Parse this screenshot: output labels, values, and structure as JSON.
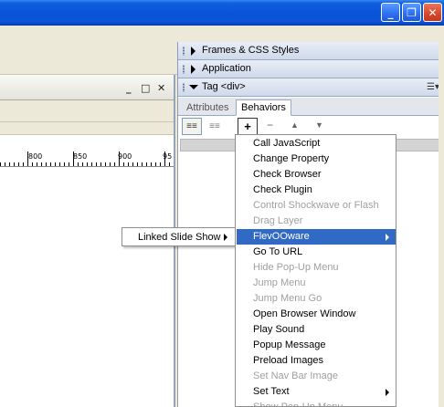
{
  "window": {
    "minimize_icon": "minimize-icon",
    "maximize_icon": "restore-icon",
    "close_icon": "close-icon"
  },
  "document": {
    "controls": {
      "minimize": "_",
      "restore": "□",
      "close": "✕"
    },
    "ruler_labels": [
      "800",
      "850",
      "900",
      "95"
    ]
  },
  "panels": {
    "frames_css": "Frames & CSS Styles",
    "application": "Application",
    "tag": "Tag <div>"
  },
  "tabs": {
    "attributes": "Attributes",
    "behaviors": "Behaviors"
  },
  "toolbar": {
    "add": "+",
    "remove": "−",
    "up": "▲",
    "down": "▼"
  },
  "submenu": {
    "label": "Linked Slide Show"
  },
  "menu": {
    "items": [
      {
        "label": "Call JavaScript",
        "disabled": false,
        "submenu": false
      },
      {
        "label": "Change Property",
        "disabled": false,
        "submenu": false
      },
      {
        "label": "Check Browser",
        "disabled": false,
        "submenu": false
      },
      {
        "label": "Check Plugin",
        "disabled": false,
        "submenu": false
      },
      {
        "label": "Control Shockwave or Flash",
        "disabled": true,
        "submenu": false
      },
      {
        "label": "Drag Layer",
        "disabled": true,
        "submenu": false
      },
      {
        "label": "FlevOOware",
        "disabled": false,
        "submenu": true,
        "highlighted": true
      },
      {
        "label": "Go To URL",
        "disabled": false,
        "submenu": false
      },
      {
        "label": "Hide Pop-Up Menu",
        "disabled": true,
        "submenu": false
      },
      {
        "label": "Jump Menu",
        "disabled": true,
        "submenu": false
      },
      {
        "label": "Jump Menu Go",
        "disabled": true,
        "submenu": false
      },
      {
        "label": "Open Browser Window",
        "disabled": false,
        "submenu": false
      },
      {
        "label": "Play Sound",
        "disabled": false,
        "submenu": false
      },
      {
        "label": "Popup Message",
        "disabled": false,
        "submenu": false
      },
      {
        "label": "Preload Images",
        "disabled": false,
        "submenu": false
      },
      {
        "label": "Set Nav Bar Image",
        "disabled": true,
        "submenu": false
      },
      {
        "label": "Set Text",
        "disabled": false,
        "submenu": true
      },
      {
        "label": "Show Pop-Up Menu",
        "disabled": true,
        "submenu": false
      }
    ]
  },
  "colors": {
    "highlight": "#316ac5",
    "disabled_text": "#a0a0a0",
    "titlebar": "#0a53d6"
  }
}
